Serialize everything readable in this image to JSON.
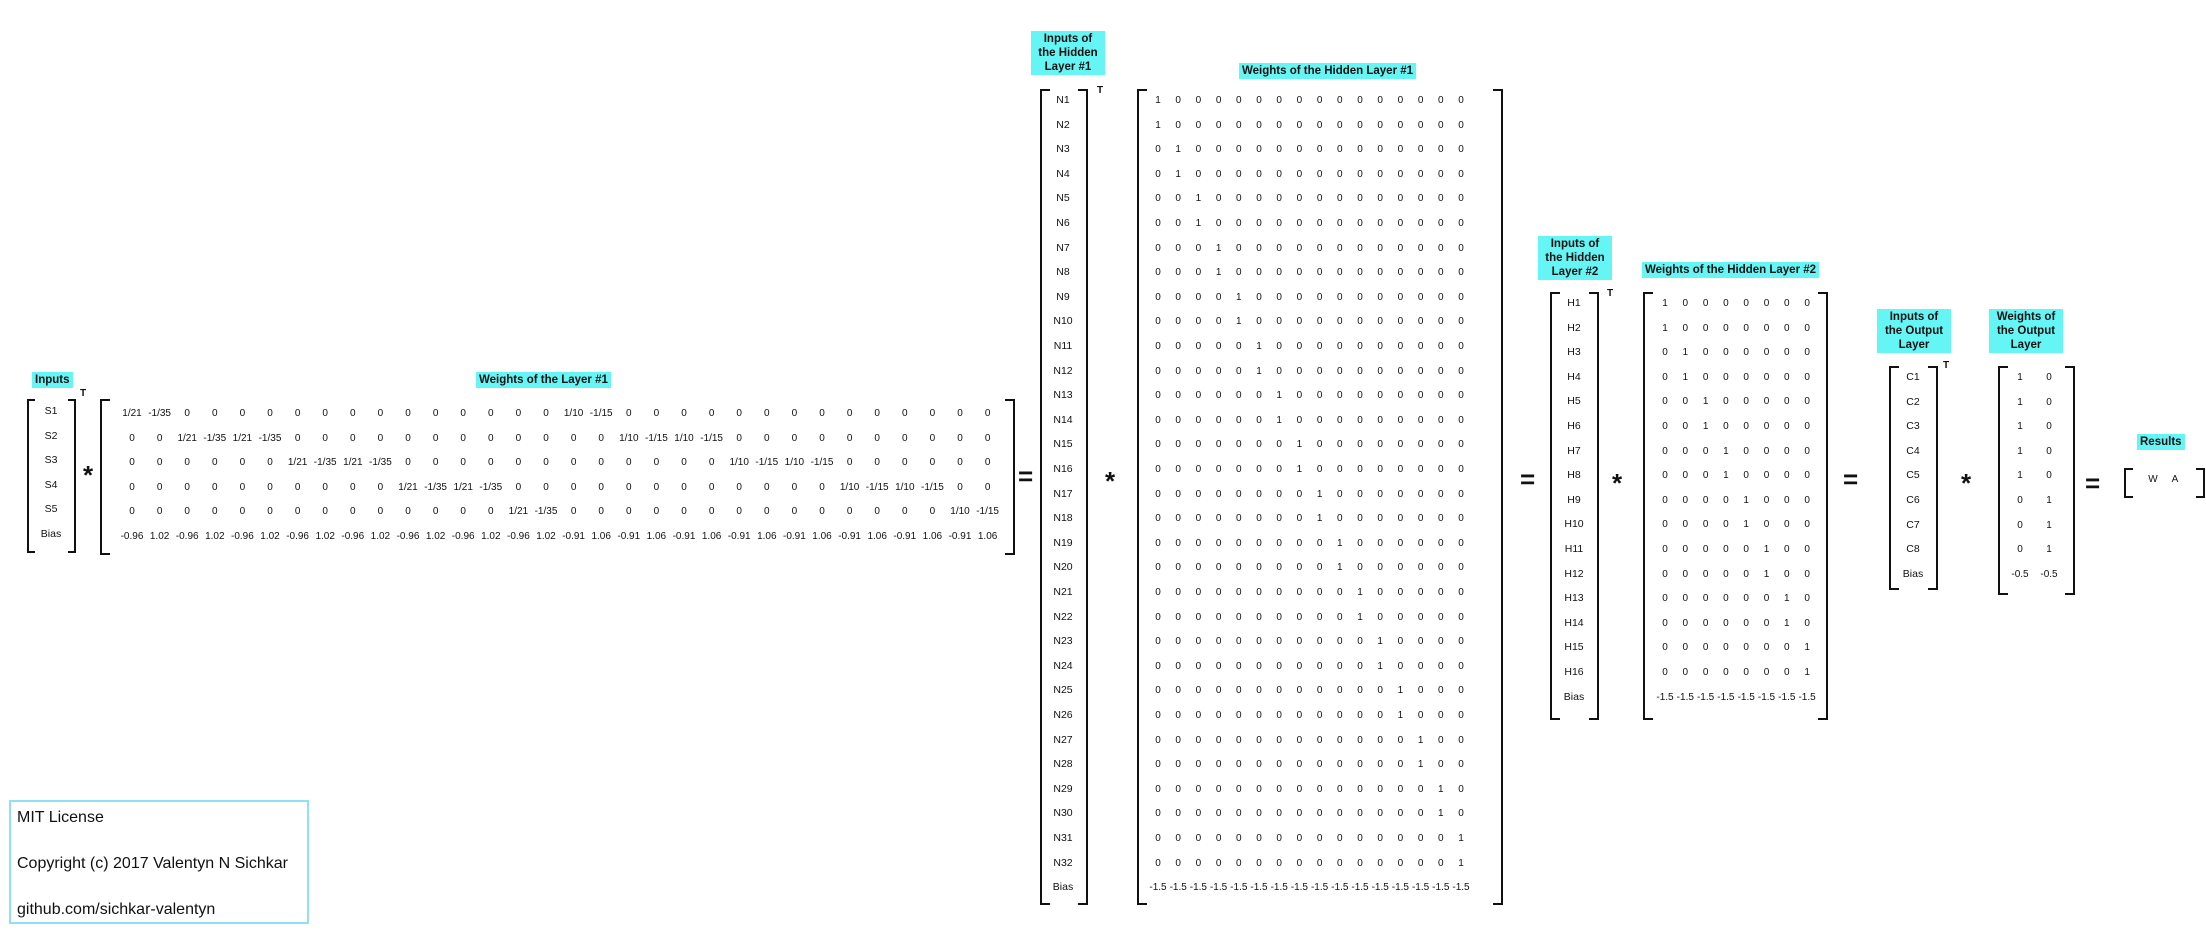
{
  "inputs": {
    "title": "Inputs",
    "items": [
      "S1",
      "S2",
      "S3",
      "S4",
      "S5",
      "Bias"
    ],
    "transpose": "T"
  },
  "weights_layer1": {
    "title": "Weights of the Layer #1",
    "rows": [
      [
        "1/21",
        "-1/35",
        "0",
        "0",
        "0",
        "0",
        "0",
        "0",
        "0",
        "0",
        "0",
        "0",
        "0",
        "0",
        "0",
        "0",
        "1/10",
        "-1/15",
        "0",
        "0",
        "0",
        "0",
        "0",
        "0",
        "0",
        "0",
        "0",
        "0",
        "0",
        "0",
        "0",
        "0"
      ],
      [
        "0",
        "0",
        "1/21",
        "-1/35",
        "1/21",
        "-1/35",
        "0",
        "0",
        "0",
        "0",
        "0",
        "0",
        "0",
        "0",
        "0",
        "0",
        "0",
        "0",
        "1/10",
        "-1/15",
        "1/10",
        "-1/15",
        "0",
        "0",
        "0",
        "0",
        "0",
        "0",
        "0",
        "0",
        "0",
        "0"
      ],
      [
        "0",
        "0",
        "0",
        "0",
        "0",
        "0",
        "1/21",
        "-1/35",
        "1/21",
        "-1/35",
        "0",
        "0",
        "0",
        "0",
        "0",
        "0",
        "0",
        "0",
        "0",
        "0",
        "0",
        "0",
        "1/10",
        "-1/15",
        "1/10",
        "-1/15",
        "0",
        "0",
        "0",
        "0",
        "0",
        "0"
      ],
      [
        "0",
        "0",
        "0",
        "0",
        "0",
        "0",
        "0",
        "0",
        "0",
        "0",
        "1/21",
        "-1/35",
        "1/21",
        "-1/35",
        "0",
        "0",
        "0",
        "0",
        "0",
        "0",
        "0",
        "0",
        "0",
        "0",
        "0",
        "0",
        "1/10",
        "-1/15",
        "1/10",
        "-1/15",
        "0",
        "0"
      ],
      [
        "0",
        "0",
        "0",
        "0",
        "0",
        "0",
        "0",
        "0",
        "0",
        "0",
        "0",
        "0",
        "0",
        "0",
        "1/21",
        "-1/35",
        "0",
        "0",
        "0",
        "0",
        "0",
        "0",
        "0",
        "0",
        "0",
        "0",
        "0",
        "0",
        "0",
        "0",
        "1/10",
        "-1/15"
      ],
      [
        "-0.96",
        "1.02",
        "-0.96",
        "1.02",
        "-0.96",
        "1.02",
        "-0.96",
        "1.02",
        "-0.96",
        "1.02",
        "-0.96",
        "1.02",
        "-0.96",
        "1.02",
        "-0.96",
        "1.02",
        "-0.91",
        "1.06",
        "-0.91",
        "1.06",
        "-0.91",
        "1.06",
        "-0.91",
        "1.06",
        "-0.91",
        "1.06",
        "-0.91",
        "1.06",
        "-0.91",
        "1.06",
        "-0.91",
        "1.06"
      ]
    ]
  },
  "hidden1_inputs": {
    "title": "Inputs of the Hidden Layer #1",
    "items": [
      "N1",
      "N2",
      "N3",
      "N4",
      "N5",
      "N6",
      "N7",
      "N8",
      "N9",
      "N10",
      "N11",
      "N12",
      "N13",
      "N14",
      "N15",
      "N16",
      "N17",
      "N18",
      "N19",
      "N20",
      "N21",
      "N22",
      "N23",
      "N24",
      "N25",
      "N26",
      "N27",
      "N28",
      "N29",
      "N30",
      "N31",
      "N32",
      "Bias"
    ],
    "transpose": "T"
  },
  "weights_hidden1": {
    "title": "Weights of the Hidden Layer #1",
    "cols": 16,
    "bias_row": [
      "-1.5",
      "-1.5",
      "-1.5",
      "-1.5",
      "-1.5",
      "-1.5",
      "-1.5",
      "-1.5",
      "-1.5",
      "-1.5",
      "-1.5",
      "-1.5",
      "-1.5",
      "-1.5",
      "-1.5",
      "-1.5"
    ]
  },
  "hidden2_inputs": {
    "title": "Inputs of the Hidden Layer #2",
    "items": [
      "H1",
      "H2",
      "H3",
      "H4",
      "H5",
      "H6",
      "H7",
      "H8",
      "H9",
      "H10",
      "H11",
      "H12",
      "H13",
      "H14",
      "H15",
      "H16",
      "Bias"
    ],
    "transpose": "T"
  },
  "weights_hidden2": {
    "title": "Weights of the Hidden Layer #2",
    "cols": 8,
    "bias_row": [
      "-1.5",
      "-1.5",
      "-1.5",
      "-1.5",
      "-1.5",
      "-1.5",
      "-1.5",
      "-1.5"
    ]
  },
  "output_inputs": {
    "title": "Inputs of the Output Layer",
    "items": [
      "C1",
      "C2",
      "C3",
      "C4",
      "C5",
      "C6",
      "C7",
      "C8",
      "Bias"
    ],
    "transpose": "T"
  },
  "weights_output": {
    "title": "Weights of the Output Layer",
    "rows": [
      [
        "1",
        "0"
      ],
      [
        "1",
        "0"
      ],
      [
        "1",
        "0"
      ],
      [
        "1",
        "0"
      ],
      [
        "1",
        "0"
      ],
      [
        "0",
        "1"
      ],
      [
        "0",
        "1"
      ],
      [
        "0",
        "1"
      ],
      [
        "-0.5",
        "-0.5"
      ]
    ]
  },
  "results": {
    "title": "Results",
    "items": [
      "W",
      "A"
    ]
  },
  "operators": {
    "multiply": "*",
    "equals": "="
  },
  "license": {
    "line1": "MIT License",
    "line2": "Copyright (c) 2017 Valentyn N Sichkar",
    "line3": "github.com/sichkar-valentyn"
  }
}
